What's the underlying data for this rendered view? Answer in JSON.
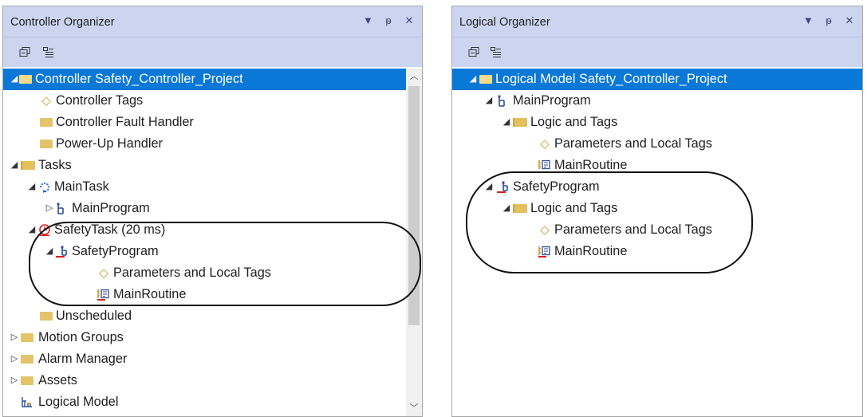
{
  "left_panel": {
    "title": "Controller Organizer",
    "title_buttons": [
      "▼",
      "ᵽ",
      "✕"
    ],
    "tree": [
      {
        "label": "Controller Safety_Controller_Project",
        "icon": "controller-folder-icon",
        "caret": "◢",
        "selected": true
      },
      {
        "label": "Controller Tags",
        "icon": "tag-icon"
      },
      {
        "label": "Controller Fault Handler",
        "icon": "folder-icon"
      },
      {
        "label": "Power-Up Handler",
        "icon": "folder-icon"
      },
      {
        "label": "Tasks",
        "icon": "open-folder-icon",
        "caret": "◢"
      },
      {
        "label": "MainTask",
        "icon": "continuous-task-icon",
        "caret": "◢"
      },
      {
        "label": "MainProgram",
        "icon": "program-icon",
        "caret": "▷"
      },
      {
        "label": "SafetyTask (20 ms)",
        "icon": "periodic-task-icon",
        "caret": "◢"
      },
      {
        "label": "SafetyProgram",
        "icon": "safety-program-icon",
        "caret": "◢"
      },
      {
        "label": "Parameters and Local Tags",
        "icon": "tag-icon"
      },
      {
        "label": "MainRoutine",
        "icon": "safety-routine-icon"
      },
      {
        "label": "Unscheduled",
        "icon": "folder-icon"
      },
      {
        "label": "Motion Groups",
        "icon": "folder-icon",
        "caret": "▷"
      },
      {
        "label": "Alarm Manager",
        "icon": "folder-icon",
        "caret": "▷"
      },
      {
        "label": "Assets",
        "icon": "folder-icon",
        "caret": "▷"
      },
      {
        "label": "Logical Model",
        "icon": "logical-model-icon"
      }
    ]
  },
  "right_panel": {
    "title": "Logical Organizer",
    "title_buttons": [
      "▼",
      "ᵽ",
      "✕"
    ],
    "tree": [
      {
        "label": "Logical Model Safety_Controller_Project",
        "icon": "controller-folder-icon",
        "caret": "◢",
        "selected": true
      },
      {
        "label": "MainProgram",
        "icon": "program-icon",
        "caret": "◢"
      },
      {
        "label": "Logic and Tags",
        "icon": "open-folder-icon",
        "caret": "◢"
      },
      {
        "label": "Parameters and Local Tags",
        "icon": "tag-icon"
      },
      {
        "label": "MainRoutine",
        "icon": "routine-icon"
      },
      {
        "label": "SafetyProgram",
        "icon": "safety-program-icon",
        "caret": "◢"
      },
      {
        "label": "Logic and Tags",
        "icon": "open-folder-icon",
        "caret": "◢"
      },
      {
        "label": "Parameters and Local Tags",
        "icon": "tag-icon"
      },
      {
        "label": "MainRoutine",
        "icon": "safety-routine-icon"
      }
    ]
  },
  "colors": {
    "titlebar": "#ccd5f0",
    "selection": "#0a78d7",
    "safety_red": "#d61f1f",
    "folder": "#e4c46a"
  }
}
